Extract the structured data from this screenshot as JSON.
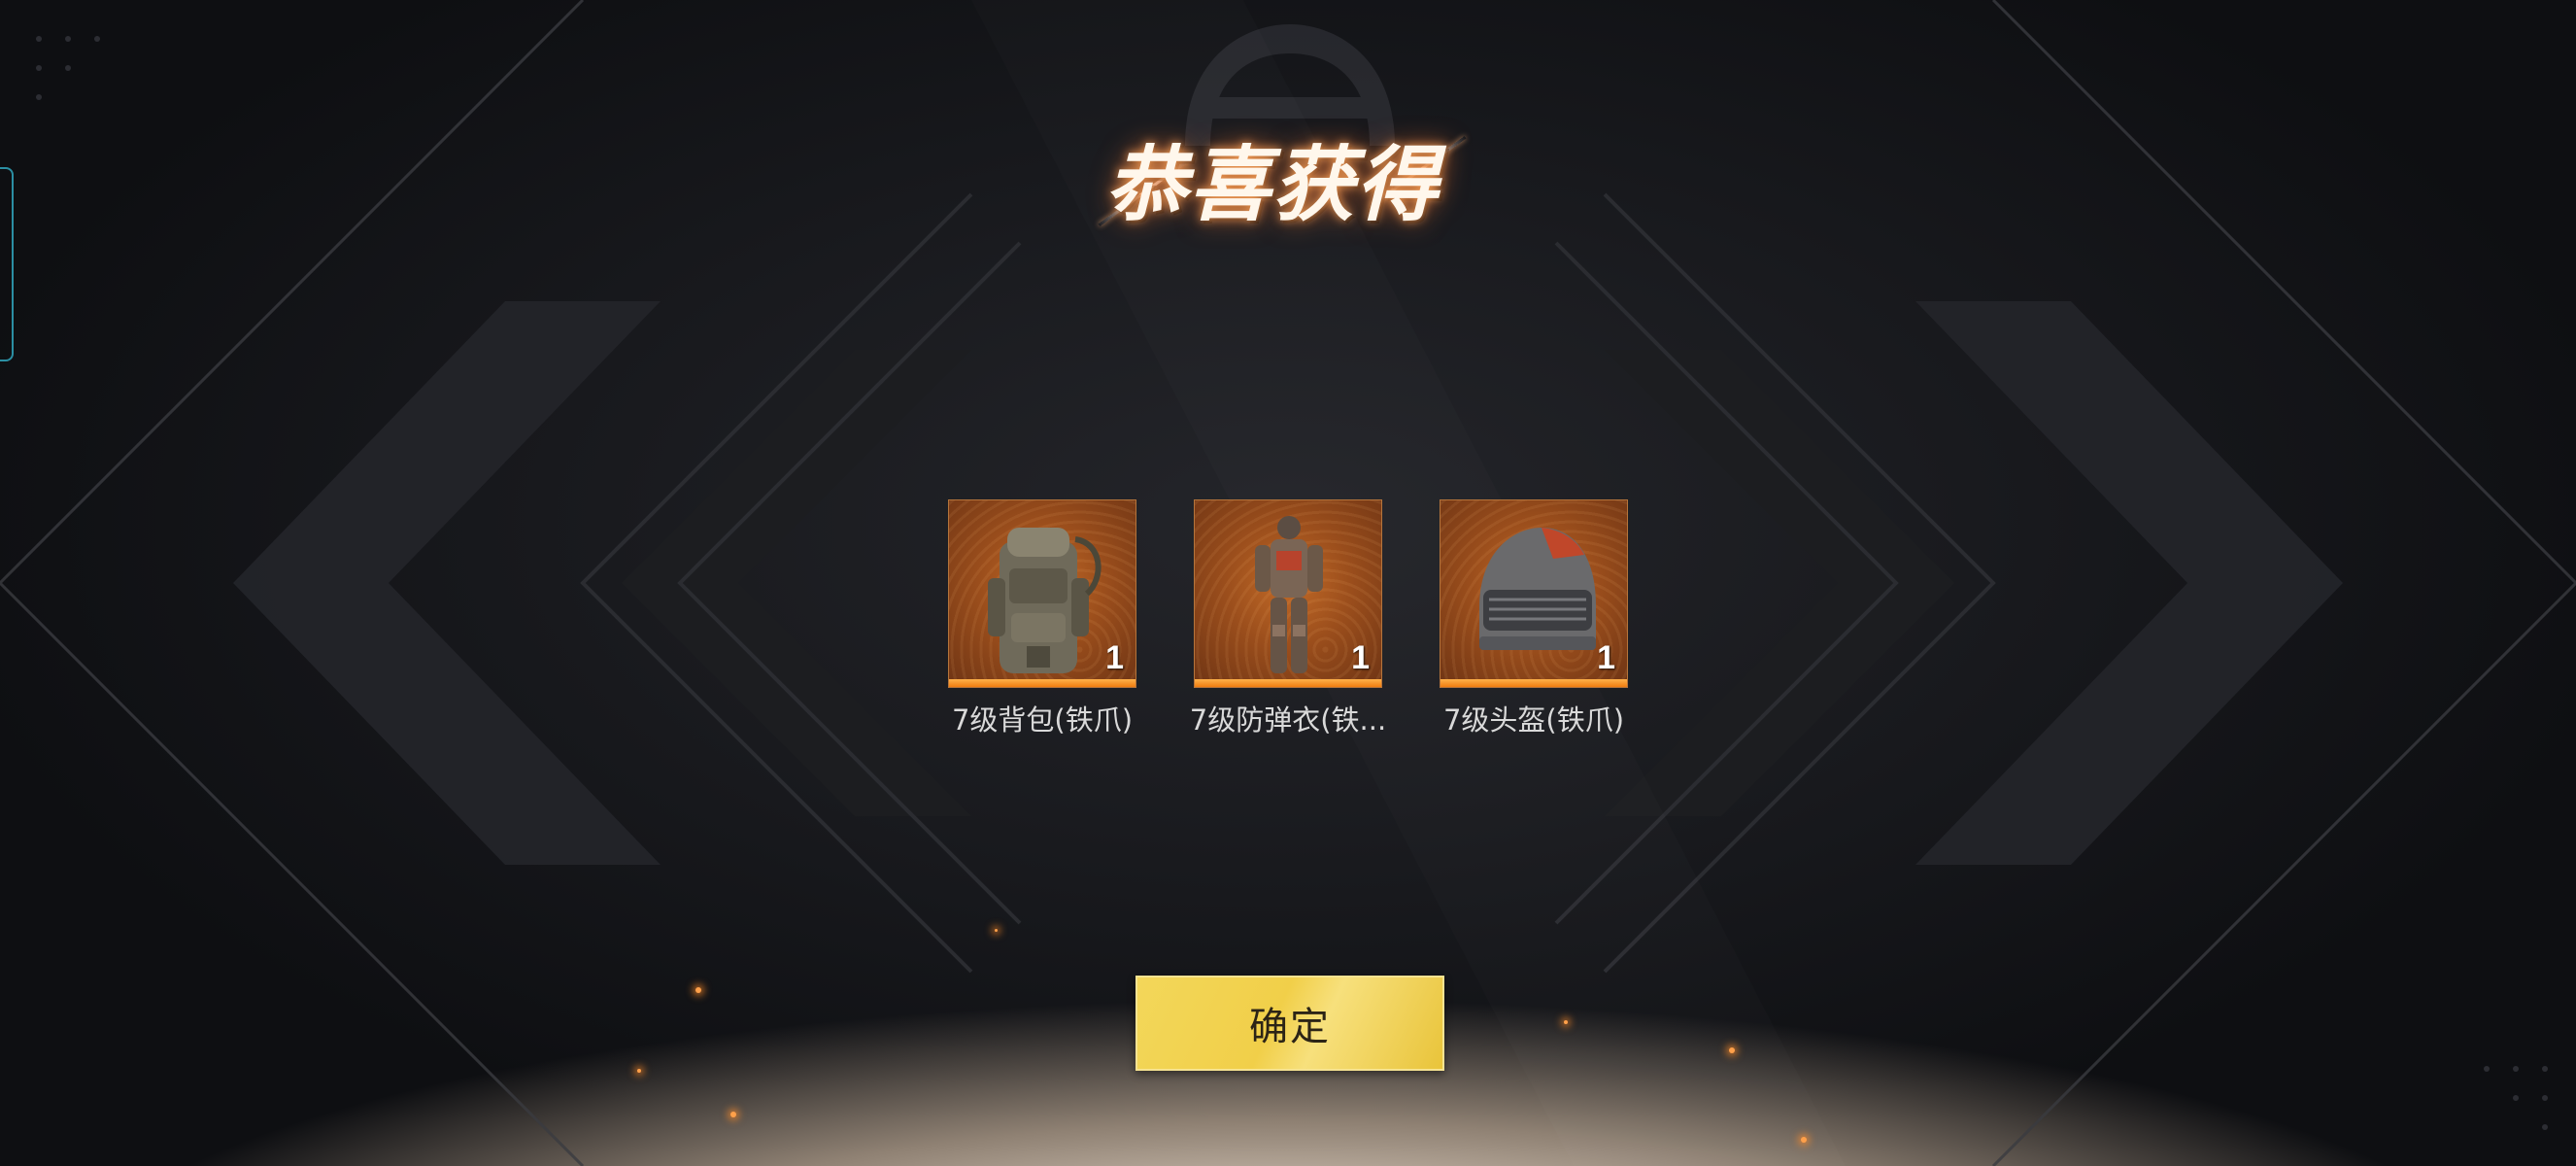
{
  "dialog": {
    "title": "恭喜获得",
    "confirm_label": "确定"
  },
  "rewards": [
    {
      "name": "7级背包(铁爪)",
      "count": "1",
      "icon": "backpack-icon"
    },
    {
      "name": "7级防弹衣(铁...",
      "count": "1",
      "icon": "armor-vest-icon"
    },
    {
      "name": "7级头盔(铁爪)",
      "count": "1",
      "icon": "helmet-icon"
    }
  ],
  "colors": {
    "tile_orange": "#9b4e1c",
    "tile_bar": "#f07d10",
    "button_gold": "#f1cf49",
    "title_glow": "#ff7832"
  }
}
